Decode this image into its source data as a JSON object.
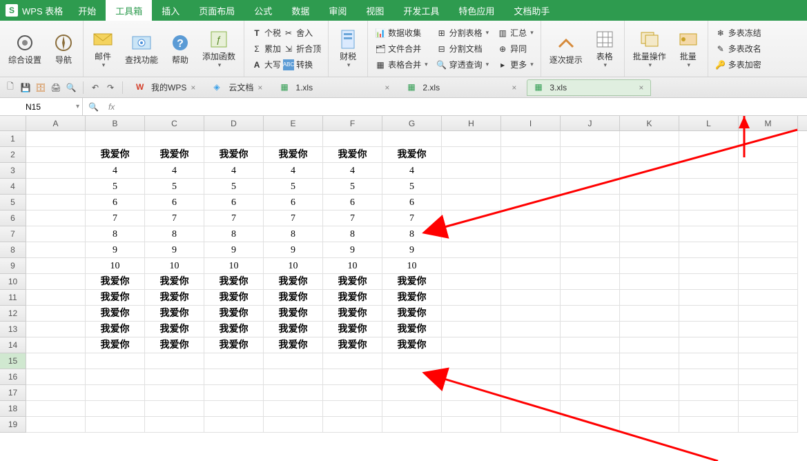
{
  "app": {
    "logo": "S",
    "name": "WPS 表格"
  },
  "menus": [
    {
      "label": "开始",
      "active": false
    },
    {
      "label": "工具箱",
      "active": true
    },
    {
      "label": "插入",
      "active": false
    },
    {
      "label": "页面布局",
      "active": false
    },
    {
      "label": "公式",
      "active": false
    },
    {
      "label": "数据",
      "active": false
    },
    {
      "label": "审阅",
      "active": false
    },
    {
      "label": "视图",
      "active": false
    },
    {
      "label": "开发工具",
      "active": false
    },
    {
      "label": "特色应用",
      "active": false
    },
    {
      "label": "文档助手",
      "active": false
    }
  ],
  "ribbon": {
    "g1_zonghe": "综合设置",
    "g1_daohang": "导航",
    "g2_youjian": "邮件",
    "g2_chazhaogn": "查找功能",
    "g2_bangzhu": "帮助",
    "g2_tianjiahanshu": "添加函数",
    "g3_geshui": "个税",
    "g3_leijia": "累加",
    "g3_daxie": "大写",
    "g3_sheru": "舍入",
    "g3_zheheding": "折合顶",
    "g3_zhuanhuan": "转换",
    "g4_caishui": "财税",
    "g5_shujushouji": "数据收集",
    "g5_wenjianhebing": "文件合并",
    "g5_biaogehebing": "表格合并",
    "g5_fengebiao": "分割表格",
    "g5_fengewendang": "分割文档",
    "g5_chuantouchaxun": "穿透查询",
    "g5_huizong": "汇总",
    "g5_yitong": "异同",
    "g5_gengduo": "更多",
    "g6_zhuictishi": "逐次提示",
    "g6_biaoge": "表格",
    "g6_piliangcaozuo": "批量操作",
    "g6_piliang": "批量",
    "g7_duobiaodongji": "多表冻结",
    "g7_duobiaogaiming": "多表改名",
    "g7_duobiaojiami": "多表加密"
  },
  "doctabs": {
    "wps": "我的WPS",
    "cloud": "云文档",
    "f1": "1.xls",
    "f2": "2.xls",
    "f3": "3.xls"
  },
  "namebox": "N15",
  "fx": "fx",
  "columns": [
    "A",
    "B",
    "C",
    "D",
    "E",
    "F",
    "G",
    "H",
    "I",
    "J",
    "K",
    "L",
    "M"
  ],
  "rowcount": 19,
  "sheet": {
    "header_text": "我爱你",
    "rows": [
      [
        "",
        "我爱你",
        "我爱你",
        "我爱你",
        "我爱你",
        "我爱你",
        "我爱你",
        "",
        "",
        "",
        "",
        "",
        ""
      ],
      [
        "",
        "4",
        "4",
        "4",
        "4",
        "4",
        "4",
        "",
        "",
        "",
        "",
        "",
        ""
      ],
      [
        "",
        "5",
        "5",
        "5",
        "5",
        "5",
        "5",
        "",
        "",
        "",
        "",
        "",
        ""
      ],
      [
        "",
        "6",
        "6",
        "6",
        "6",
        "6",
        "6",
        "",
        "",
        "",
        "",
        "",
        ""
      ],
      [
        "",
        "7",
        "7",
        "7",
        "7",
        "7",
        "7",
        "",
        "",
        "",
        "",
        "",
        ""
      ],
      [
        "",
        "8",
        "8",
        "8",
        "8",
        "8",
        "8",
        "",
        "",
        "",
        "",
        "",
        ""
      ],
      [
        "",
        "9",
        "9",
        "9",
        "9",
        "9",
        "9",
        "",
        "",
        "",
        "",
        "",
        ""
      ],
      [
        "",
        "10",
        "10",
        "10",
        "10",
        "10",
        "10",
        "",
        "",
        "",
        "",
        "",
        ""
      ],
      [
        "",
        "我爱你",
        "我爱你",
        "我爱你",
        "我爱你",
        "我爱你",
        "我爱你",
        "",
        "",
        "",
        "",
        "",
        ""
      ],
      [
        "",
        "我爱你",
        "我爱你",
        "我爱你",
        "我爱你",
        "我爱你",
        "我爱你",
        "",
        "",
        "",
        "",
        "",
        ""
      ],
      [
        "",
        "我爱你",
        "我爱你",
        "我爱你",
        "我爱你",
        "我爱你",
        "我爱你",
        "",
        "",
        "",
        "",
        "",
        ""
      ],
      [
        "",
        "我爱你",
        "我爱你",
        "我爱你",
        "我爱你",
        "我爱你",
        "我爱你",
        "",
        "",
        "",
        "",
        "",
        ""
      ],
      [
        "",
        "我爱你",
        "我爱你",
        "我爱你",
        "我爱你",
        "我爱你",
        "我爱你",
        "",
        "",
        "",
        "",
        "",
        ""
      ]
    ]
  },
  "selected_cell": "N15"
}
